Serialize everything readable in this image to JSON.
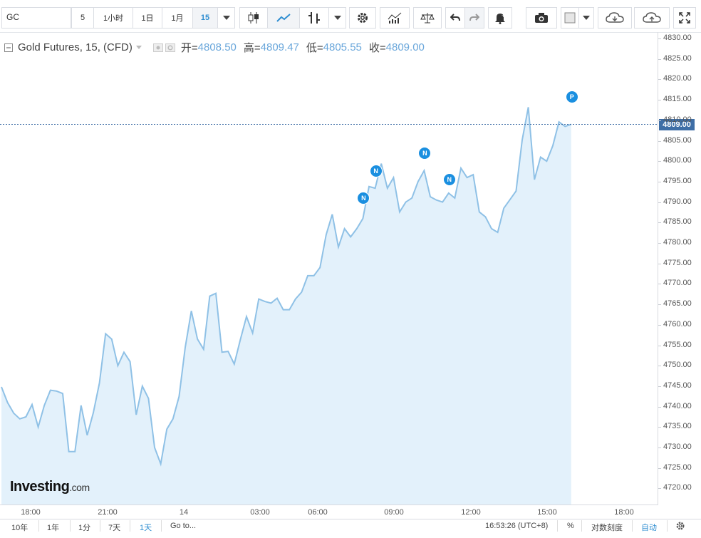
{
  "toolbar": {
    "symbol": "GC",
    "intervals": [
      "5",
      "1小时",
      "1日",
      "1月",
      "15"
    ],
    "active_interval": "15",
    "icons": [
      "chevron-down-icon",
      "candlestick-icon",
      "line-chart-icon",
      "bar-chart-icon",
      "chevron-down-icon",
      "gear-icon",
      "indicators-icon",
      "compare-icon",
      "undo-icon",
      "redo-icon",
      "alert-icon",
      "camera-icon",
      "color-swatch-icon",
      "chevron-down-icon",
      "cloud-download-icon",
      "cloud-upload-icon",
      "fullscreen-icon"
    ]
  },
  "legend": {
    "title": "Gold Futures, 15, (CFD)",
    "open_label": "开=",
    "open": "4808.50",
    "high_label": "高=",
    "high": "4809.47",
    "low_label": "低=",
    "low": "4805.55",
    "close_label": "收=",
    "close": "4809.00"
  },
  "current_price": "4809.00",
  "events": [
    {
      "label": "N",
      "index": 59
    },
    {
      "label": "N",
      "index": 61
    },
    {
      "label": "N",
      "index": 69
    },
    {
      "label": "N",
      "index": 73
    },
    {
      "label": "P",
      "index": 93
    }
  ],
  "bottom_bar": {
    "ranges": [
      "10年",
      "1年",
      "1分",
      "7天",
      "1天"
    ],
    "active_range": "1天",
    "goto": "Go to...",
    "time": "16:53:26 (UTC+8)",
    "percent": "%",
    "log_scale": "对数刻度",
    "auto": "自动"
  },
  "logo": {
    "brand": "Investing",
    "suffix": ".com"
  },
  "chart_data": {
    "type": "area",
    "title": "Gold Futures, 15, (CFD)",
    "x_tick_labels": [
      "18:00",
      "21:00",
      "14",
      "03:00",
      "06:00",
      "09:00",
      "12:00",
      "15:00",
      "18:00"
    ],
    "y_tick_labels": [
      "4830.00",
      "4825.00",
      "4820.00",
      "4815.00",
      "4810.00",
      "4805.00",
      "4800.00",
      "4795.00",
      "4790.00",
      "4785.00",
      "4780.00",
      "4775.00",
      "4770.00",
      "4765.00",
      "4760.00",
      "4755.00",
      "4750.00",
      "4745.00",
      "4740.00",
      "4735.00",
      "4730.00",
      "4725.00",
      "4720.00"
    ],
    "ylim": [
      4717.5,
      4832.5
    ],
    "grid": false,
    "color": "#8fc1e6",
    "fill": "#e3f1fb",
    "values": [
      4744.8,
      4741.0,
      4738.4,
      4737.0,
      4737.5,
      4740.5,
      4735.0,
      4740.3,
      4744.0,
      4743.8,
      4743.2,
      4729.0,
      4729.0,
      4740.3,
      4733.0,
      4738.5,
      4745.8,
      4757.8,
      4756.5,
      4750.0,
      4753.3,
      4751.0,
      4738.0,
      4745.0,
      4742.0,
      4730.0,
      4726.0,
      4734.5,
      4737.0,
      4742.5,
      4754.5,
      4763.4,
      4756.5,
      4754.0,
      4767.0,
      4767.7,
      4753.3,
      4753.5,
      4750.4,
      4756.4,
      4762.0,
      4758.0,
      4766.3,
      4765.7,
      4765.3,
      4766.5,
      4763.7,
      4763.7,
      4766.3,
      4768.0,
      4772.0,
      4772.0,
      4774.0,
      4782.0,
      4787.0,
      4779.0,
      4783.5,
      4781.5,
      4783.5,
      4786.0,
      4793.8,
      4793.4,
      4799.4,
      4793.4,
      4796.0,
      4787.6,
      4790.0,
      4791.0,
      4795.0,
      4797.7,
      4791.3,
      4790.5,
      4790.0,
      4792.2,
      4791.0,
      4798.3,
      4796.0,
      4796.7,
      4787.6,
      4786.4,
      4783.5,
      4782.6,
      4788.5,
      4790.6,
      4792.7,
      4805.2,
      4813.2,
      4795.5,
      4801.0,
      4800.0,
      4803.8,
      4809.6,
      4808.5,
      4809.0
    ]
  }
}
